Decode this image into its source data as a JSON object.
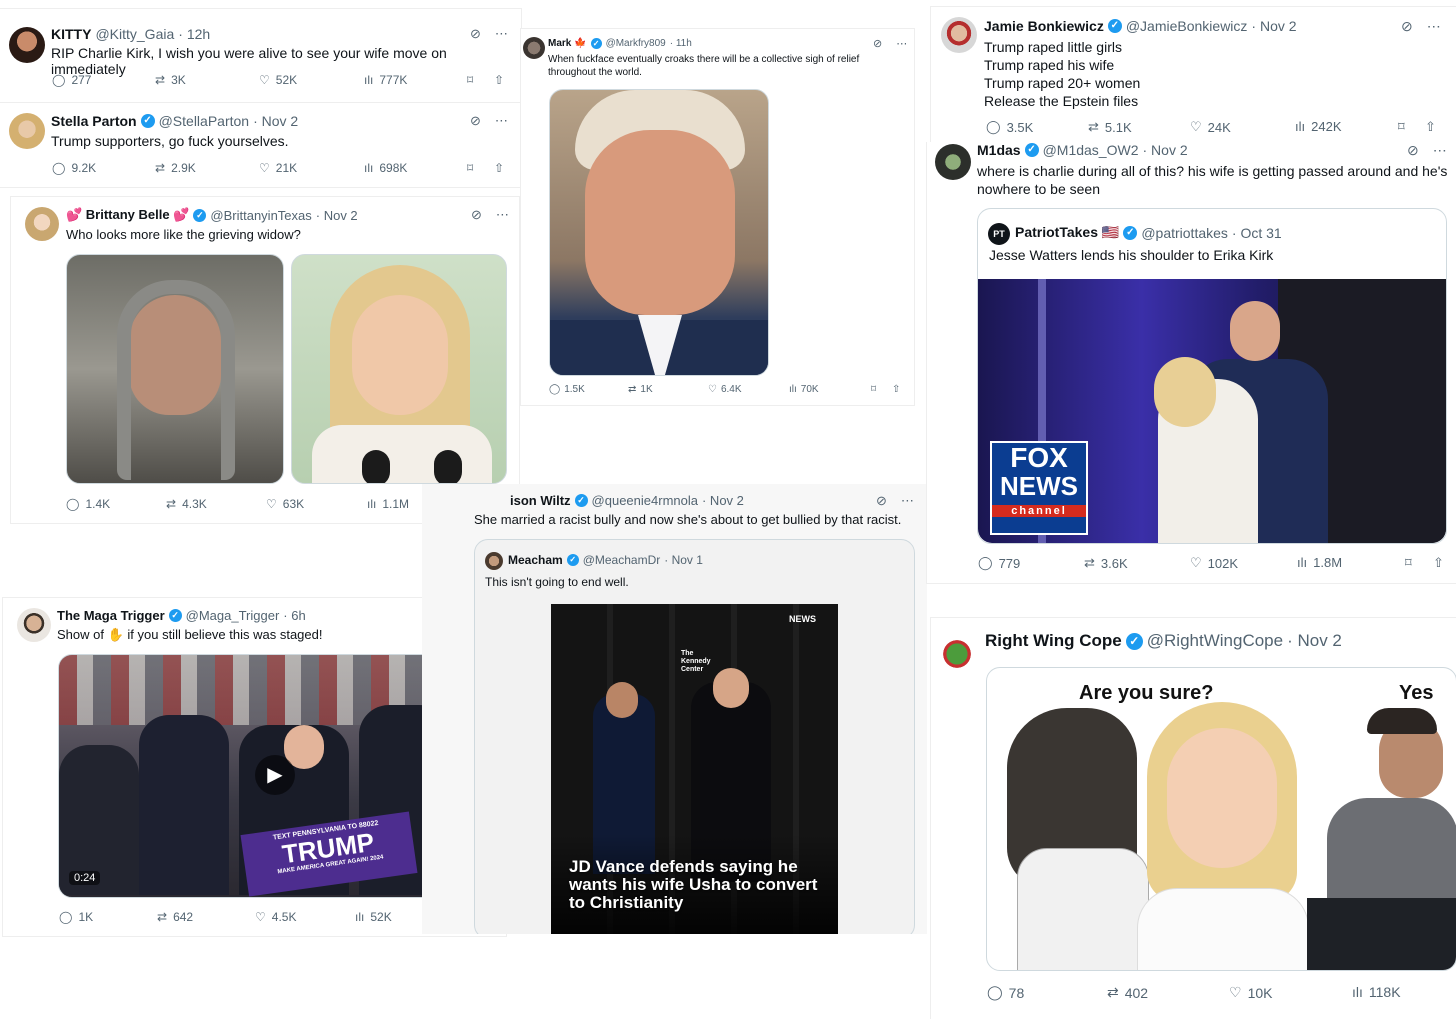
{
  "tweets": {
    "kitty": {
      "name": "KITTY",
      "handle": "@Kitty_Gaia",
      "time": "· 12h",
      "text": "RIP Charlie Kirk, I wish you were alive to see your wife move on immediately",
      "replies": "277",
      "retweets": "3K",
      "likes": "52K",
      "views": "777K"
    },
    "stella": {
      "name": "Stella Parton",
      "handle": "@StellaParton",
      "time": "· Nov 2",
      "text": "Trump supporters, go fuck yourselves.",
      "replies": "9.2K",
      "retweets": "2.9K",
      "likes": "21K",
      "views": "698K"
    },
    "brittany": {
      "name": "💕 Brittany Belle 💕",
      "handle": "@BrittanyinTexas",
      "time": "· Nov 2",
      "text": "Who looks more like the grieving widow?",
      "replies": "1.4K",
      "retweets": "4.3K",
      "likes": "63K",
      "views": "1.1M"
    },
    "maga": {
      "name": "The Maga Trigger",
      "handle": "@Maga_Trigger",
      "time": "· 6h",
      "text": "Show of ✋ if you still believe this was staged!",
      "video_time": "0:24",
      "banner_top": "TEXT PENNSYLVANIA TO 88022",
      "banner_main": "TRUMP",
      "banner_sub": "MAKE AMERICA GREAT AGAIN! 2024",
      "replies": "1K",
      "retweets": "642",
      "likes": "4.5K",
      "views": "52K"
    },
    "mark": {
      "name": "Mark 🍁",
      "handle": "@Markfry809",
      "time": "· 11h",
      "text": "When fuckface eventually croaks there will be a collective sigh of relief\nthroughout the world.",
      "replies": "1.5K",
      "retweets": "1K",
      "likes": "6.4K",
      "views": "70K"
    },
    "allison": {
      "name": "ison Wiltz",
      "handle": "@queenie4rmnola",
      "time": "· Nov 2",
      "text": "She married a racist bully and now she's about to get bullied by that racist.",
      "quote_name": "Meacham",
      "quote_handle": "@MeachamDr",
      "quote_time": "· Nov 1",
      "quote_text": "This isn't going to end well.",
      "image_caption": "JD Vance defends saying he wants his wife Usha to convert to Christianity",
      "image_badge": "NEWS",
      "backdrop_label": "The Kennedy Center"
    },
    "jamie": {
      "name": "Jamie Bonkiewicz",
      "handle": "@JamieBonkiewicz",
      "time": "· Nov 2",
      "text": "Trump raped little girls\nTrump raped his wife\nTrump raped 20+ women\nRelease the Epstein files",
      "replies": "3.5K",
      "retweets": "5.1K",
      "likes": "24K",
      "views": "242K"
    },
    "midas": {
      "name": "M1das",
      "handle": "@M1das_OW2",
      "time": "· Nov 2",
      "text": "where is charlie during all of this? his wife is getting passed around and he's nowhere to be seen",
      "quote_name": "PatriotTakes 🇺🇸",
      "quote_handle": "@patriottakes",
      "quote_time": "· Oct 31",
      "quote_text": "Jesse Watters lends his shoulder to Erika Kirk",
      "quote_avatar": "PT",
      "logo_line1": "FOX",
      "logo_line2": "NEWS",
      "logo_line3": "channel",
      "replies": "779",
      "retweets": "3.6K",
      "likes": "102K",
      "views": "1.8M"
    },
    "rwc": {
      "name": "Right Wing Cope",
      "handle": "@RightWingCope",
      "time": "· Nov 2",
      "meme_left": "Are you sure?",
      "meme_right": "Yes",
      "replies": "78",
      "retweets": "402",
      "likes": "10K",
      "views": "118K"
    }
  },
  "colors": {
    "accent": "#1d9bf0",
    "muted": "#536471",
    "border": "#cfd9de"
  },
  "icons": [
    "reply-icon",
    "retweet-icon",
    "like-icon",
    "views-icon",
    "bookmark-icon",
    "share-icon",
    "grok-icon",
    "more-icon",
    "verified-icon",
    "play-icon"
  ]
}
